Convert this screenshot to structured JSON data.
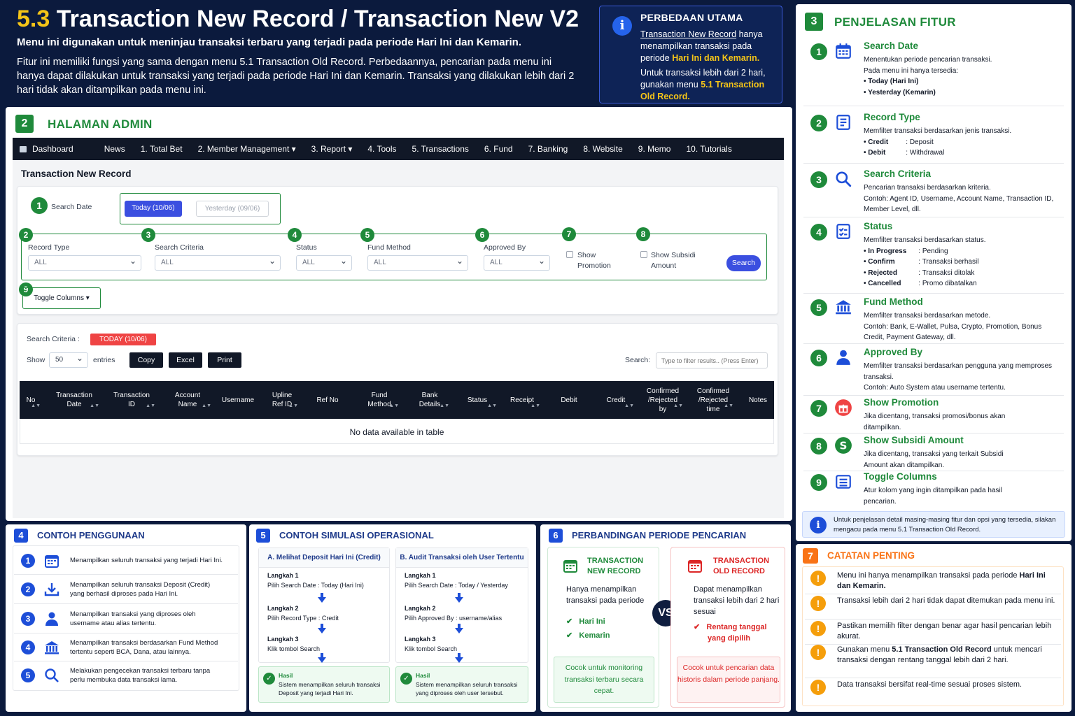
{
  "header": {
    "number": "5.3",
    "title": "Transaction New Record / Transaction New V2",
    "subtitle": "Menu ini digunakan untuk meninjau transaksi terbaru yang terjadi pada periode Hari Ini dan Kemarin.",
    "description": "Fitur ini memiliki fungsi yang sama dengan menu 5.1 Transaction Old Record. Perbedaannya, pencarian pada menu ini hanya dapat dilakukan untuk transaksi yang terjadi pada periode Hari Ini dan Kemarin. Transaksi yang dilakukan lebih dari 2 hari tidak akan ditampilkan pada menu ini."
  },
  "info_box": {
    "title": "PERBEDAAN UTAMA",
    "link": "Transaction New Record",
    "p1_rest": " hanya menampilkan transaksi pada periode ",
    "p1_hl": "Hari Ini dan Kemarin.",
    "p2": "Untuk transaksi lebih dari 2 hari, gunakan menu ",
    "p2_hl": "5.1 Transaction Old Record."
  },
  "admin": {
    "section_number": "2",
    "section_title": "HALAMAN ADMIN",
    "nav": [
      "Dashboard",
      "News",
      "1. Total Bet",
      "2. Member Management ▾",
      "3. Report ▾",
      "4. Tools",
      "5. Transactions",
      "6. Fund",
      "7. Banking",
      "8. Website",
      "9. Memo",
      "10. Tutorials"
    ],
    "page_title": "Transaction New Record",
    "search_date_label": "Search Date",
    "today_button": "Today (10/06)",
    "yesterday_button": "Yesterday (09/06)",
    "filters": {
      "record_type": {
        "label": "Record Type",
        "value": "ALL"
      },
      "search_criteria": {
        "label": "Search Criteria",
        "value": "ALL"
      },
      "status": {
        "label": "Status",
        "value": "ALL"
      },
      "fund_method": {
        "label": "Fund Method",
        "value": "ALL"
      },
      "approved_by": {
        "label": "Approved By",
        "value": "ALL"
      },
      "show_promotion": "Show Promotion",
      "show_subsidi": "Show Subsidi Amount",
      "search_button": "Search"
    },
    "toggle_columns": "Toggle Columns ▾",
    "criteria_label": "Search Criteria :",
    "criteria_badge": "TODAY (10/06)",
    "show_label": "Show",
    "entries_value": "50",
    "entries_label": "entries",
    "buttons": [
      "Copy",
      "Excel",
      "Print"
    ],
    "search_label": "Search:",
    "search_placeholder": "Type to filter results.. (Press Enter)",
    "columns": [
      "No",
      "Transaction Date",
      "Transaction ID",
      "Account Name",
      "Username",
      "Upline Ref ID",
      "Ref No",
      "Fund Method",
      "Bank Details",
      "Status",
      "Receipt",
      "Debit",
      "Credit",
      "Confirmed /Rejected by",
      "Confirmed /Rejected time",
      "Notes"
    ],
    "empty_text": "No data available in table"
  },
  "features": {
    "section_number": "3",
    "title": "PENJELASAN FITUR",
    "items": [
      {
        "n": "1",
        "icon": "calendar-icon",
        "title": "Search Date",
        "desc": "Menentukan periode pencarian transaksi.",
        "desc2": "Pada menu ini hanya tersedia:",
        "bullets": [
          "Today (Hari Ini)",
          "Yesterday (Kemarin)"
        ]
      },
      {
        "n": "2",
        "icon": "list-icon",
        "title": "Record Type",
        "desc": "Memfilter transaksi berdasarkan jenis transaksi.",
        "pairs": [
          [
            "Credit",
            ": Deposit"
          ],
          [
            "Debit",
            ": Withdrawal"
          ]
        ]
      },
      {
        "n": "3",
        "icon": "search-icon",
        "title": "Search Criteria",
        "desc": "Pencarian transaksi berdasarkan kriteria.",
        "desc2": "Contoh: Agent ID, Username, Account Name, Transaction ID, Member Level, dll."
      },
      {
        "n": "4",
        "icon": "checklist-icon",
        "title": "Status",
        "desc": "Memfilter transaksi berdasarkan status.",
        "pairs": [
          [
            "In Progress",
            ": Pending"
          ],
          [
            "Confirm",
            ": Transaksi berhasil"
          ],
          [
            "Rejected",
            ": Transaksi ditolak"
          ],
          [
            "Cancelled",
            ": Promo dibatalkan"
          ]
        ]
      },
      {
        "n": "5",
        "icon": "bank-icon",
        "title": "Fund Method",
        "desc": "Memfilter transaksi berdasarkan metode.",
        "desc2": "Contoh: Bank, E-Wallet, Pulsa, Crypto, Promotion, Bonus Credit, Payment Gateway, dll."
      },
      {
        "n": "6",
        "icon": "user-icon",
        "title": "Approved By",
        "desc": "Memfilter transaksi berdasarkan pengguna yang memproses transaksi.",
        "desc2": "Contoh: Auto System atau username tertentu."
      },
      {
        "n": "7",
        "icon": "gift-icon",
        "title": "Show Promotion",
        "desc": "Jika dicentang, transaksi promosi/bonus akan ditampilkan."
      },
      {
        "n": "8",
        "icon": "dollar-icon",
        "title": "Show Subsidi Amount",
        "desc": "Jika dicentang, transaksi yang terkait Subsidi Amount akan ditampilkan."
      },
      {
        "n": "9",
        "icon": "columns-icon",
        "title": "Toggle Columns",
        "desc": "Atur kolom yang ingin ditampilkan pada hasil pencarian."
      }
    ],
    "footer_note": "Untuk penjelasan detail masing-masing fitur dan opsi yang tersedia, silakan mengacu pada menu 5.1 Transaction Old Record."
  },
  "usage": {
    "section_number": "4",
    "title": "CONTOH PENGGUNAAN",
    "items": [
      {
        "n": "1",
        "text": "Menampilkan seluruh transaksi yang terjadi Hari Ini."
      },
      {
        "n": "2",
        "text": "Menampilkan seluruh transaksi Deposit (Credit) yang berhasil diproses pada Hari Ini."
      },
      {
        "n": "3",
        "text": "Menampilkan transaksi yang diproses oleh username atau alias tertentu."
      },
      {
        "n": "4",
        "text": "Menampilkan transaksi berdasarkan Fund Method tertentu seperti BCA, Dana, atau lainnya."
      },
      {
        "n": "5",
        "text": "Melakukan pengecekan transaksi terbaru tanpa perlu membuka data transaksi lama."
      }
    ]
  },
  "simulation": {
    "section_number": "5",
    "title": "CONTOH SIMULASI OPERASIONAL",
    "a": {
      "title": "A. Melihat Deposit Hari Ini (Credit)",
      "steps": [
        [
          "Langkah 1",
          "Pilih Search Date : Today (Hari Ini)"
        ],
        [
          "Langkah 2",
          "Pilih Record Type  : Credit"
        ],
        [
          "Langkah 3",
          "Klik tombol Search"
        ]
      ],
      "result_title": "Hasil",
      "result": "Sistem menampilkan seluruh transaksi Deposit yang terjadi Hari Ini."
    },
    "b": {
      "title": "B. Audit Transaksi oleh User Tertentu",
      "steps": [
        [
          "Langkah 1",
          "Pilih Search Date : Today / Yesterday"
        ],
        [
          "Langkah 2",
          "Pilih Approved By  : username/alias"
        ],
        [
          "Langkah 3",
          "Klik tombol Search"
        ]
      ],
      "result_title": "Hasil",
      "result": "Sistem menampilkan seluruh transaksi yang diproses oleh user tersebut."
    }
  },
  "comparison": {
    "section_number": "6",
    "title": "PERBANDINGAN PERIODE PENCARIAN",
    "new": {
      "title": "TRANSACTION NEW RECORD",
      "desc": "Hanya menampilkan transaksi pada periode",
      "checks": [
        "Hari Ini",
        "Kemarin"
      ],
      "footer": "Cocok untuk monitoring transaksi terbaru secara cepat."
    },
    "vs": "VS",
    "old": {
      "title": "TRANSACTION OLD RECORD",
      "desc": "Dapat menampilkan transaksi lebih dari 2 hari sesuai",
      "checks": [
        "Rentang tanggal yang dipilih"
      ],
      "footer": "Cocok untuk pencarian data historis dalam periode panjang."
    }
  },
  "notes": {
    "section_number": "7",
    "title": "CATATAN PENTING",
    "items": [
      {
        "pre": "Menu ini hanya menampilkan transaksi pada periode ",
        "bold": "Hari Ini dan Kemarin.",
        "post": ""
      },
      {
        "pre": "Transaksi lebih dari 2 hari tidak dapat ditemukan pada menu ini.",
        "bold": "",
        "post": ""
      },
      {
        "pre": "Pastikan memilih filter dengan benar agar hasil pencarian lebih akurat.",
        "bold": "",
        "post": ""
      },
      {
        "pre": "Gunakan menu ",
        "bold": "5.1 Transaction Old Record",
        "post": " untuk mencari transaksi dengan rentang tanggal lebih dari 2 hari."
      },
      {
        "pre": "Data transaksi bersifat real-time sesuai proses sistem.",
        "bold": "",
        "post": ""
      }
    ]
  },
  "colors": {
    "accent_green": "#1f8a3b",
    "accent_blue": "#1d4ed8",
    "highlight_yellow": "#f5c518",
    "warning_orange": "#f59e0b",
    "danger_red": "#dc2626"
  }
}
